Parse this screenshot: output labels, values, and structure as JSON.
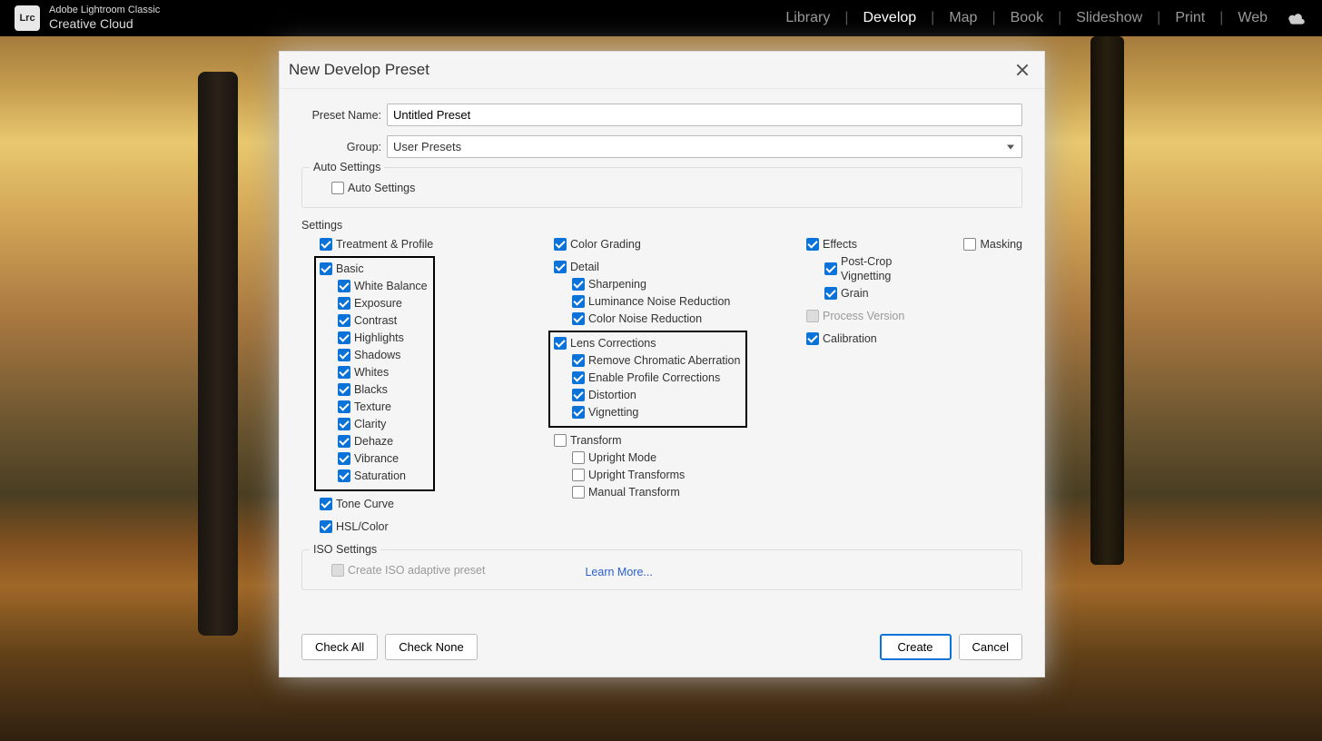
{
  "app": {
    "logo_text": "Lrc",
    "name": "Adobe Lightroom Classic",
    "suite": "Creative Cloud"
  },
  "modules": {
    "items": [
      "Library",
      "Develop",
      "Map",
      "Book",
      "Slideshow",
      "Print",
      "Web"
    ],
    "active_index": 1
  },
  "dialog": {
    "title": "New Develop Preset",
    "labels": {
      "preset_name": "Preset Name:",
      "group": "Group:"
    },
    "values": {
      "preset_name": "Untitled Preset",
      "group": "User Presets"
    },
    "sections": {
      "auto_settings": "Auto Settings",
      "settings": "Settings",
      "iso_settings": "ISO Settings"
    },
    "auto_settings": {
      "label": "Auto Settings",
      "checked": false
    },
    "col1": {
      "treatment_profile": {
        "label": "Treatment & Profile",
        "checked": true
      },
      "basic": {
        "label": "Basic",
        "checked": true,
        "children": [
          {
            "label": "White Balance",
            "checked": true
          },
          {
            "label": "Exposure",
            "checked": true
          },
          {
            "label": "Contrast",
            "checked": true
          },
          {
            "label": "Highlights",
            "checked": true
          },
          {
            "label": "Shadows",
            "checked": true
          },
          {
            "label": "Whites",
            "checked": true
          },
          {
            "label": "Blacks",
            "checked": true
          },
          {
            "label": "Texture",
            "checked": true
          },
          {
            "label": "Clarity",
            "checked": true
          },
          {
            "label": "Dehaze",
            "checked": true
          },
          {
            "label": "Vibrance",
            "checked": true
          },
          {
            "label": "Saturation",
            "checked": true
          }
        ]
      },
      "tone_curve": {
        "label": "Tone Curve",
        "checked": true
      },
      "hsl_color": {
        "label": "HSL/Color",
        "checked": true
      }
    },
    "col2": {
      "color_grading": {
        "label": "Color Grading",
        "checked": true
      },
      "detail": {
        "label": "Detail",
        "checked": true,
        "children": [
          {
            "label": "Sharpening",
            "checked": true
          },
          {
            "label": "Luminance Noise Reduction",
            "checked": true
          },
          {
            "label": "Color Noise Reduction",
            "checked": true
          }
        ]
      },
      "lens_corrections": {
        "label": "Lens Corrections",
        "checked": true,
        "children": [
          {
            "label": "Remove Chromatic Aberration",
            "checked": true
          },
          {
            "label": "Enable Profile Corrections",
            "checked": true
          },
          {
            "label": "Distortion",
            "checked": true
          },
          {
            "label": "Vignetting",
            "checked": true
          }
        ]
      },
      "transform": {
        "label": "Transform",
        "checked": false,
        "children": [
          {
            "label": "Upright Mode",
            "checked": false
          },
          {
            "label": "Upright Transforms",
            "checked": false
          },
          {
            "label": "Manual Transform",
            "checked": false
          }
        ]
      }
    },
    "col3": {
      "effects": {
        "label": "Effects",
        "checked": true,
        "children": [
          {
            "label": "Post-Crop Vignetting",
            "checked": true
          },
          {
            "label": "Grain",
            "checked": true
          }
        ]
      },
      "masking": {
        "label": "Masking",
        "checked": false,
        "disabled": false
      },
      "process_version": {
        "label": "Process Version",
        "checked": false,
        "disabled": true
      },
      "calibration": {
        "label": "Calibration",
        "checked": true
      }
    },
    "iso": {
      "create_adaptive": {
        "label": "Create ISO adaptive preset",
        "checked": false,
        "disabled": true
      },
      "learn_more": "Learn More..."
    },
    "buttons": {
      "check_all": "Check All",
      "check_none": "Check None",
      "create": "Create",
      "cancel": "Cancel"
    }
  }
}
